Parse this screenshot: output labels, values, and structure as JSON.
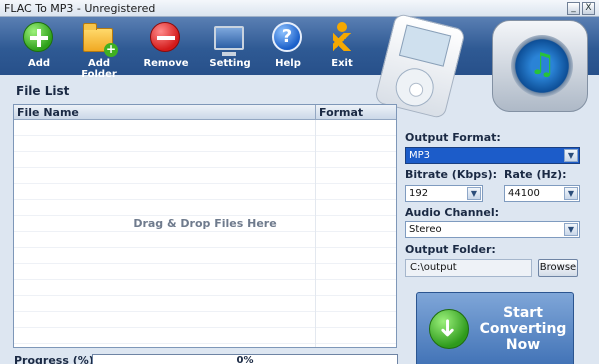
{
  "window": {
    "title": "FLAC To MP3 - Unregistered",
    "minimize": "_",
    "close": "X"
  },
  "toolbar": {
    "buttons": [
      {
        "label": "Add",
        "icon": "add-icon"
      },
      {
        "label": "Add Folder",
        "icon": "add-folder-icon"
      },
      {
        "label": "Remove",
        "icon": "remove-icon"
      },
      {
        "label": "Setting",
        "icon": "monitor-icon"
      },
      {
        "label": "Help",
        "icon": "help-icon"
      },
      {
        "label": "Exit",
        "icon": "exit-icon"
      }
    ],
    "help_glyph": "?"
  },
  "file_list": {
    "title": "File List",
    "columns": [
      "File Name",
      "Format"
    ],
    "drop_hint": "Drag & Drop Files Here",
    "rows": []
  },
  "progress": {
    "label": "Progress (%):",
    "value": 0,
    "text": "0%"
  },
  "settings": {
    "output_format_label": "Output Format:",
    "output_format": "MP3",
    "bitrate_label": "Bitrate (Kbps):",
    "bitrate": "192",
    "rate_label": "Rate (Hz):",
    "rate": "44100",
    "channel_label": "Audio Channel:",
    "channel": "Stereo",
    "folder_label": "Output Folder:",
    "folder": "C:\\output",
    "browse": "Browse"
  },
  "start_button": {
    "line1": "Start",
    "line2": "Converting",
    "line3": "Now"
  },
  "colors": {
    "toolbar": "#2f5a94",
    "background": "#dde6f1",
    "accent": "#1c5cc9"
  }
}
